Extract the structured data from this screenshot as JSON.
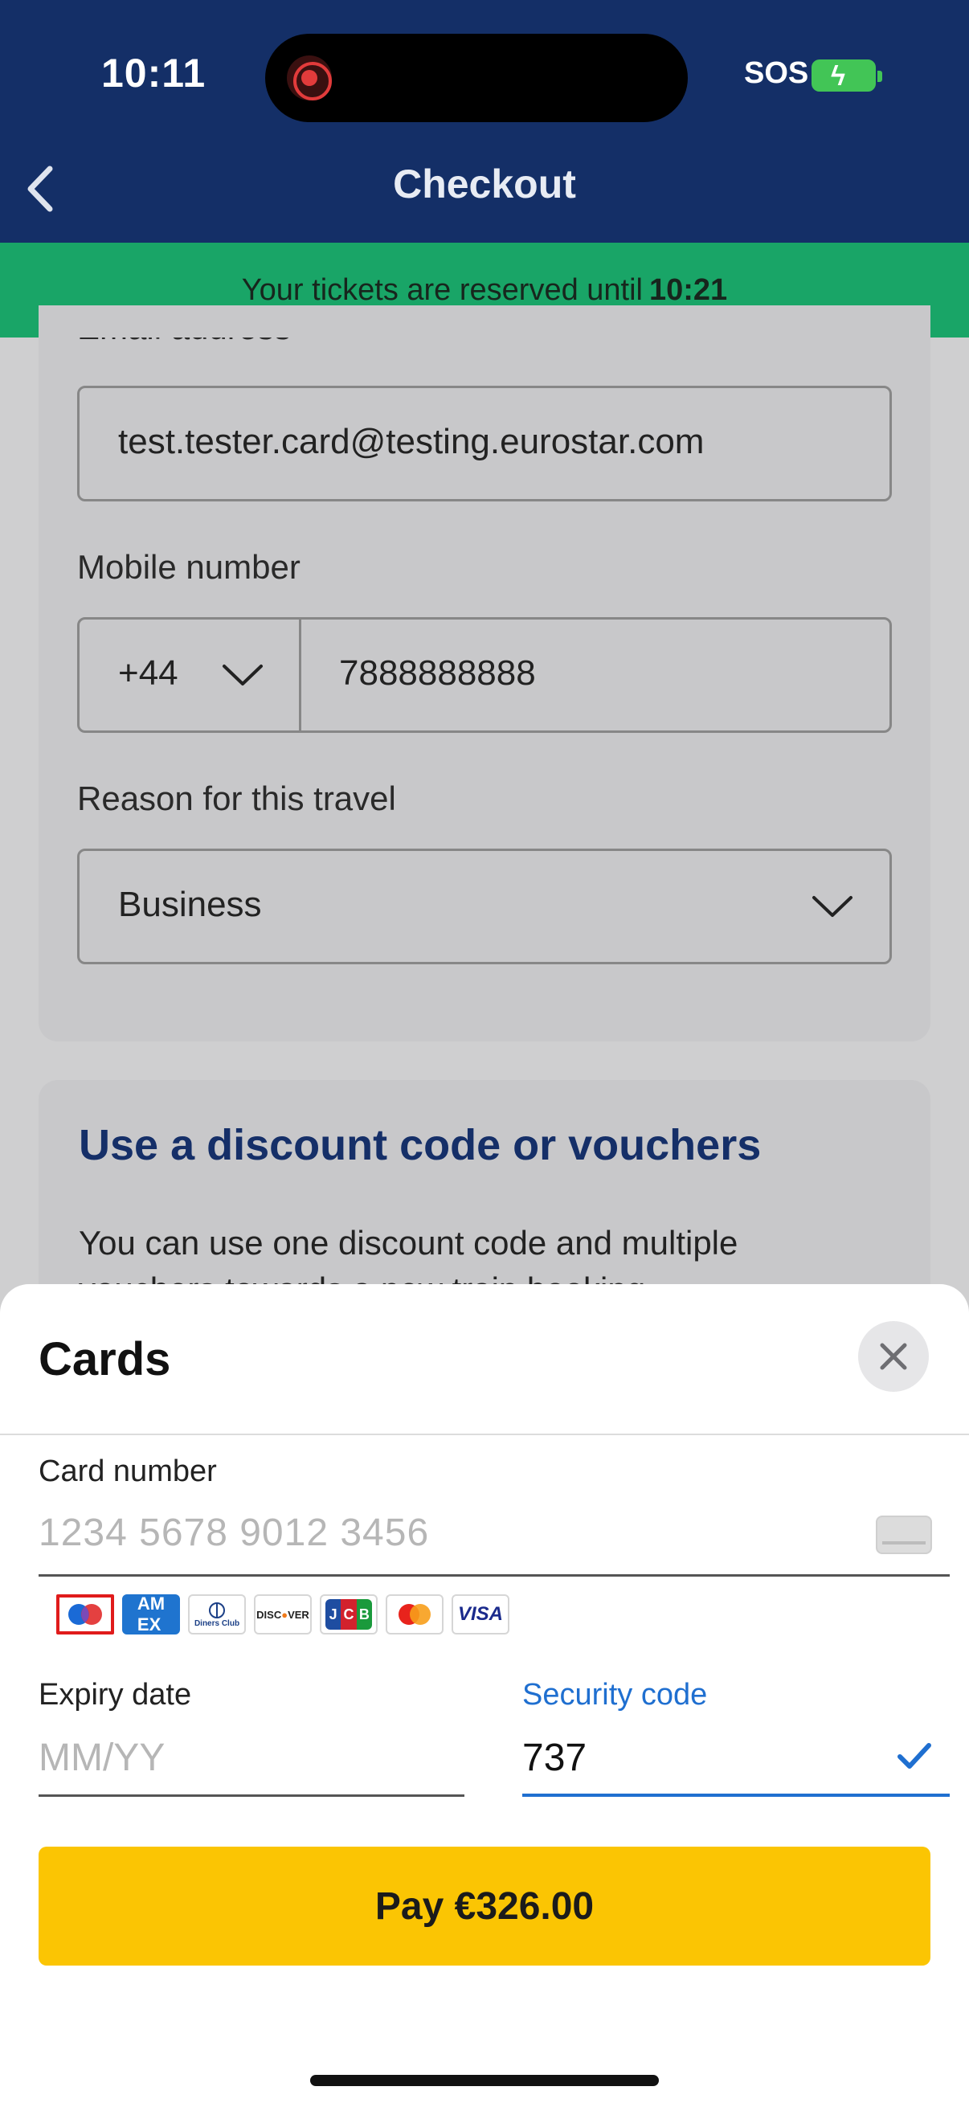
{
  "status_bar": {
    "time": "10:11",
    "sos": "SOS"
  },
  "header": {
    "title": "Checkout",
    "back_icon": "chevron-left-icon"
  },
  "banner": {
    "text": "Your tickets are reserved until",
    "time": "10:21",
    "color": "#19a567"
  },
  "form": {
    "email_label": "Email address",
    "email_value": "test.tester.card@testing.eurostar.com",
    "mobile_label": "Mobile number",
    "country_code": "+44",
    "mobile_value": "7888888888",
    "reason_label": "Reason for this travel",
    "reason_value": "Business"
  },
  "discount": {
    "title": "Use a discount code or vouchers",
    "description": "You can use one discount code and multiple vouchers towards a new train booking."
  },
  "sheet": {
    "title": "Cards",
    "close_icon": "close-icon",
    "card_number_label": "Card number",
    "card_number_placeholder": "1234 5678 9012 3456",
    "brands": [
      "maestro",
      "amex",
      "diners",
      "discover",
      "jcb",
      "mastercard",
      "visa"
    ],
    "selected_brand": "maestro",
    "expiry_label": "Expiry date",
    "expiry_placeholder": "MM/YY",
    "security_label": "Security code",
    "security_value": "737",
    "pay_label": "Pay €326.00"
  },
  "colors": {
    "navy": "#142f67",
    "accent_blue": "#1f6fd0",
    "pay_yellow": "#fbc503"
  }
}
